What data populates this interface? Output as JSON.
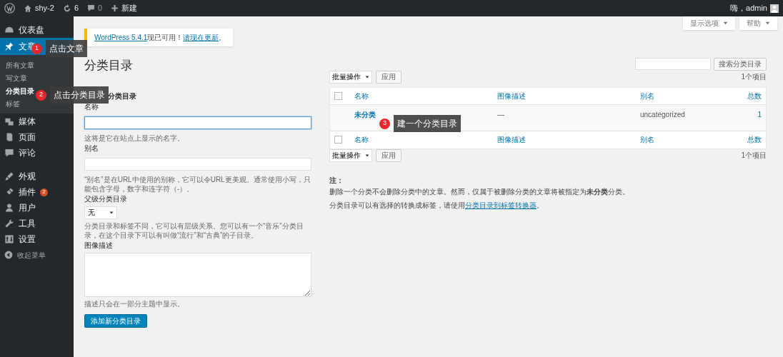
{
  "admin_bar": {
    "site": "shy-2",
    "updates": "6",
    "comments": "0",
    "new": "新建",
    "greeting": "嗨，admin"
  },
  "sidebar": {
    "items": [
      {
        "label": "仪表盘",
        "selected": false
      },
      {
        "label": "文章",
        "selected": true,
        "children": [
          {
            "label": "所有文章",
            "selected": false
          },
          {
            "label": "写文章",
            "selected": false
          },
          {
            "label": "分类目录",
            "selected": true
          },
          {
            "label": "标签",
            "selected": false
          }
        ]
      },
      {
        "label": "媒体",
        "selected": false
      },
      {
        "label": "页面",
        "selected": false
      },
      {
        "label": "评论",
        "selected": false
      },
      {
        "label": "外观",
        "selected": false
      },
      {
        "label": "插件",
        "selected": false,
        "badge": "2"
      },
      {
        "label": "用户",
        "selected": false
      },
      {
        "label": "工具",
        "selected": false
      },
      {
        "label": "设置",
        "selected": false
      }
    ],
    "collapse": "收起菜单"
  },
  "screen_buttons": [
    "显示选项",
    "帮助"
  ],
  "notice": {
    "version_link": "WordPress 5.4.1",
    "text": "现已可用！",
    "update_link": "请现在更新",
    "end": "。"
  },
  "page_title": "分类目录",
  "search": {
    "button": "搜索分类目录"
  },
  "add_form": {
    "heading": "分类目录",
    "fields": [
      {
        "kind": "text",
        "label": "名称",
        "focused": true,
        "hint": "这将是它在站点上显示的名字。"
      },
      {
        "kind": "text",
        "label": "别名",
        "focused": false,
        "hint": "“别名”是在URL中使用的别称，它可以令URL更美观。通常使用小写，只能包含字母，数字和连字符（-）。"
      },
      {
        "kind": "select",
        "label": "父级分类目录",
        "value": "无",
        "hint": "分类目录和标签不同，它可以有层级关系。您可以有一个“音乐”分类目录，在这个目录下可以有叫做“流行”和“古典”的子目录。"
      },
      {
        "kind": "textarea",
        "label": "图像描述",
        "hint": "描述只会在一部分主题中显示。"
      }
    ],
    "submit": "添加新分类目录"
  },
  "bulk_top": {
    "action": "批量操作",
    "apply": "应用",
    "count": "1个项目"
  },
  "bulk_bottom": {
    "action": "批量操作",
    "apply": "应用",
    "count": "1个项目"
  },
  "table": {
    "header_columns": [
      "名称",
      "图像描述",
      "别名",
      "总数"
    ],
    "rows": [
      {
        "cells": [
          "未分类",
          "—",
          "uncategorized",
          "1"
        ]
      }
    ],
    "footer_columns": [
      "名称",
      "图像描述",
      "别名",
      "总数"
    ],
    "header_checked": false,
    "footer_checked": false
  },
  "notes": {
    "title": "注：",
    "lines": [
      "删除一个分类不会删除分类中的文章。然而，仅属于被删除分类的文章将被指定为**未分类**分类。"
    ],
    "converter_prefix": "分类目录可以有选择的转换成标签，请使用",
    "converter_link": "分类目录到标签转换器",
    "converter_suffix": "。"
  },
  "callouts": [
    {
      "number": "1",
      "text": "点击文章"
    },
    {
      "number": "2",
      "text": "点击分类目录"
    },
    {
      "number": "3",
      "text": "建一个分类目录"
    }
  ]
}
